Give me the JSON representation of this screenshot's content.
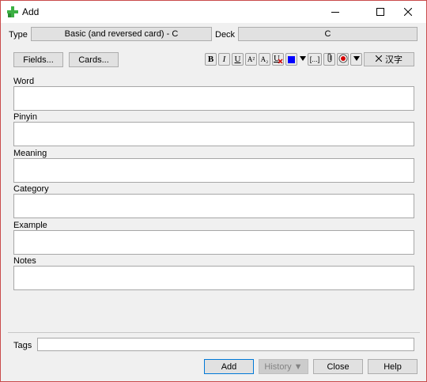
{
  "window": {
    "title": "Add",
    "color_accent": "#0078d7"
  },
  "selectors": {
    "type_label": "Type",
    "type_value": "Basic (and reversed card) - C",
    "deck_label": "Deck",
    "deck_value": "C"
  },
  "buttons": {
    "fields": "Fields...",
    "cards": "Cards...",
    "clear_format": "汉字",
    "add": "Add",
    "history": "History ▼",
    "close": "Close",
    "help": "Help"
  },
  "toolbar": {
    "bold": "B",
    "italic": "I",
    "underline": "U",
    "superscript": "A²",
    "subscript": "A₂",
    "cloze": "[...]",
    "text_color": "#0000ff"
  },
  "fields": [
    {
      "label": "Word",
      "value": ""
    },
    {
      "label": "Pinyin",
      "value": ""
    },
    {
      "label": "Meaning",
      "value": ""
    },
    {
      "label": "Category",
      "value": ""
    },
    {
      "label": "Example",
      "value": ""
    },
    {
      "label": "Notes",
      "value": ""
    }
  ],
  "tags": {
    "label": "Tags",
    "value": ""
  }
}
